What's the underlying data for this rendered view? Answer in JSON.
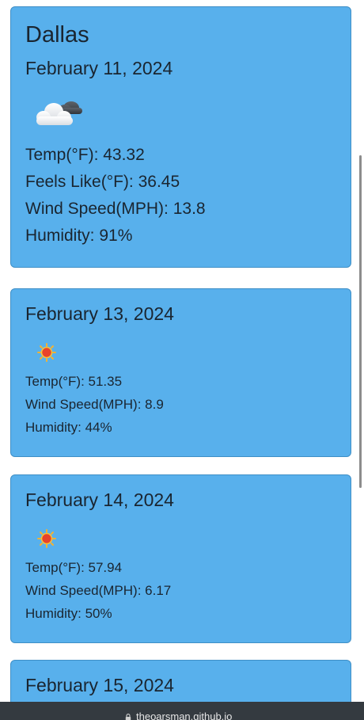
{
  "current": {
    "city": "Dallas",
    "date": "February 11, 2024",
    "icon": "cloudy-night-icon",
    "temp": "Temp(°F): 43.32",
    "feels_like": "Feels Like(°F): 36.45",
    "wind": "Wind Speed(MPH): 13.8",
    "humidity": "Humidity: 91%"
  },
  "forecast": [
    {
      "date": "February 13, 2024",
      "icon": "sun-icon",
      "temp": "Temp(°F): 51.35",
      "wind": "Wind Speed(MPH): 8.9",
      "humidity": "Humidity: 44%"
    },
    {
      "date": "February 14, 2024",
      "icon": "sun-icon",
      "temp": "Temp(°F): 57.94",
      "wind": "Wind Speed(MPH): 6.17",
      "humidity": "Humidity: 50%"
    },
    {
      "date": "February 15, 2024"
    }
  ],
  "browser": {
    "url": "theoarsman.github.io"
  },
  "colors": {
    "card": "#58b0ec",
    "card_border": "#3f8fc6",
    "text": "#1a2530",
    "browser_bar": "#343a40"
  }
}
